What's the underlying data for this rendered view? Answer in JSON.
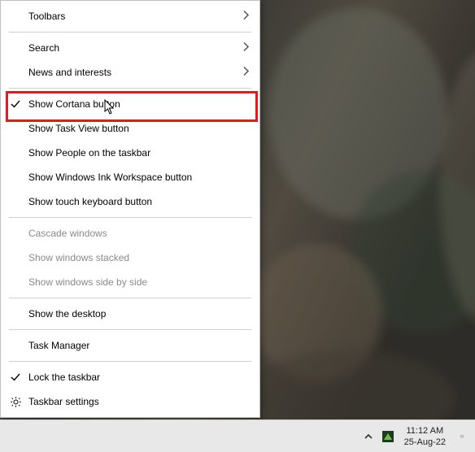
{
  "menu": {
    "sections": [
      {
        "items": [
          {
            "label": "Toolbars",
            "submenu": true
          }
        ]
      },
      {
        "items": [
          {
            "label": "Search",
            "submenu": true
          },
          {
            "label": "News and interests",
            "submenu": true
          }
        ]
      },
      {
        "items": [
          {
            "label": "Show Cortana button",
            "checked": true,
            "highlighted": true
          },
          {
            "label": "Show Task View button"
          },
          {
            "label": "Show People on the taskbar"
          },
          {
            "label": "Show Windows Ink Workspace button"
          },
          {
            "label": "Show touch keyboard button"
          }
        ]
      },
      {
        "items": [
          {
            "label": "Cascade windows",
            "disabled": true
          },
          {
            "label": "Show windows stacked",
            "disabled": true
          },
          {
            "label": "Show windows side by side",
            "disabled": true
          }
        ]
      },
      {
        "items": [
          {
            "label": "Show the desktop"
          }
        ]
      },
      {
        "items": [
          {
            "label": "Task Manager"
          }
        ]
      },
      {
        "items": [
          {
            "label": "Lock the taskbar",
            "checked": true
          },
          {
            "label": "Taskbar settings",
            "icon": "gear"
          }
        ]
      }
    ]
  },
  "tray": {
    "time": "11:12 AM",
    "date": "25-Aug-22"
  }
}
